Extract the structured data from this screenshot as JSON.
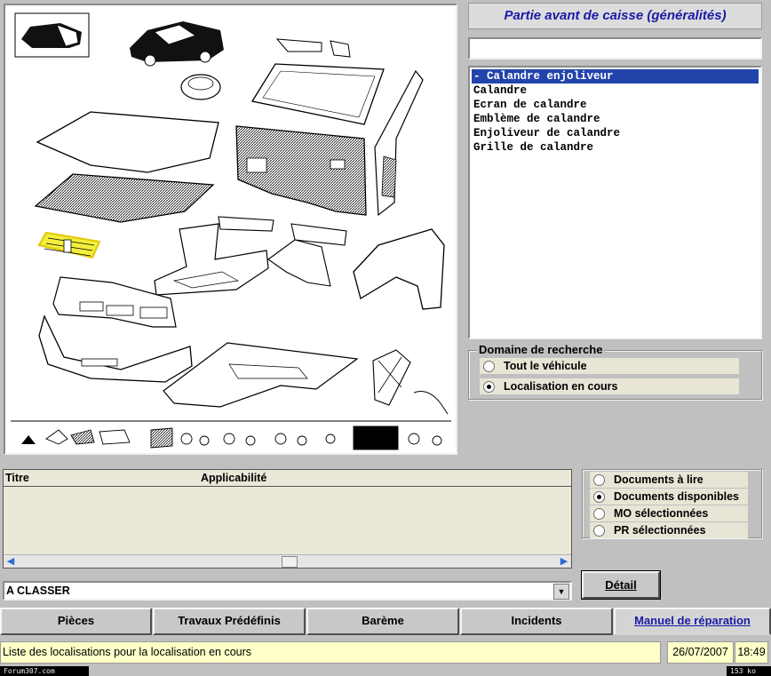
{
  "header": {
    "title": "Partie avant de caisse (généralités)"
  },
  "search": {
    "value": ""
  },
  "parts_list": {
    "items": [
      {
        "label": "- Calandre enjoliveur",
        "selected": true
      },
      {
        "label": "Calandre",
        "selected": false
      },
      {
        "label": "Ecran de calandre",
        "selected": false
      },
      {
        "label": "Emblème de calandre",
        "selected": false
      },
      {
        "label": "Enjoliveur de calandre",
        "selected": false
      },
      {
        "label": "Grille de calandre",
        "selected": false
      }
    ]
  },
  "search_domain": {
    "legend": "Domaine de recherche",
    "options": [
      {
        "label": "Tout le véhicule",
        "checked": false
      },
      {
        "label": "Localisation en cours",
        "checked": true
      }
    ]
  },
  "documents_table": {
    "columns": [
      "Titre",
      "Applicabilité"
    ],
    "rows": []
  },
  "doc_filter": {
    "options": [
      {
        "label": "Documents à lire",
        "checked": false
      },
      {
        "label": "Documents disponibles",
        "checked": true
      },
      {
        "label": "MO sélectionnées",
        "checked": false
      },
      {
        "label": "PR sélectionnées",
        "checked": false
      }
    ]
  },
  "category_combo": {
    "value": "A CLASSER"
  },
  "detail_button": {
    "label": "Détail"
  },
  "tabs": [
    {
      "label": "Pièces",
      "active": false
    },
    {
      "label": "Travaux Prédéfinis",
      "active": false
    },
    {
      "label": "Barème",
      "active": false
    },
    {
      "label": "Incidents",
      "active": false
    },
    {
      "label": "Manuel de réparation",
      "active": true
    }
  ],
  "status": {
    "message": "Liste des localisations pour la localisation en cours",
    "date": "26/07/2007",
    "time": "18:49"
  },
  "footer": {
    "left": "Forum307.com",
    "right": "153 ko"
  },
  "colors": {
    "accent_blue": "#1a1aa6",
    "selection": "#2244aa",
    "highlight_part": "#f2ee3c",
    "status_bg": "#ffffc8"
  }
}
